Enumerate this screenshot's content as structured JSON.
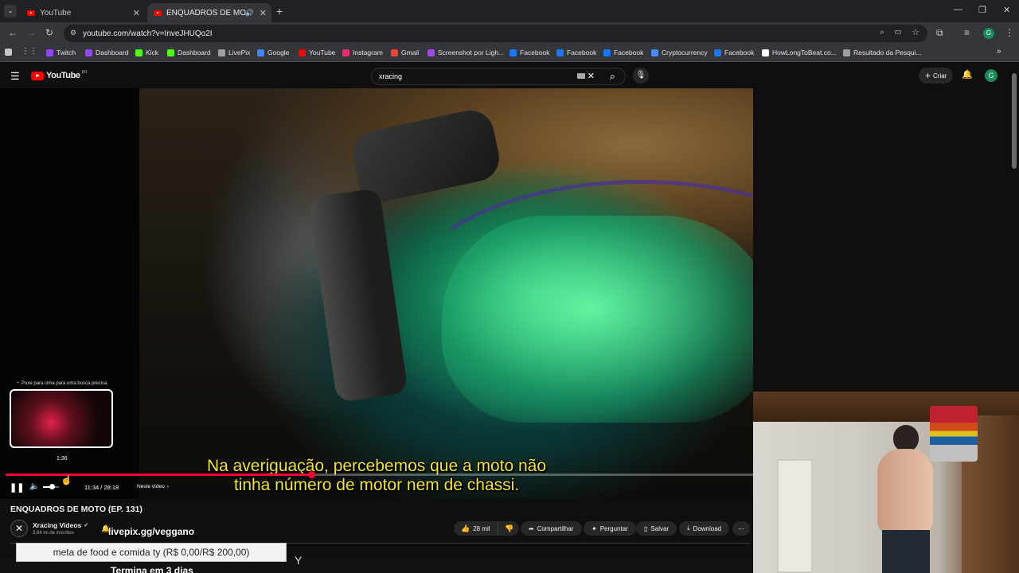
{
  "browser": {
    "tabs": [
      {
        "label": "YouTube",
        "active": false
      },
      {
        "label": "ENQUADROS DE MOTO (EP",
        "active": true
      }
    ],
    "url": "youtube.com/watch?v=InveJHUQo2I",
    "bookmarks": [
      {
        "label": "Twitch",
        "color": "#9146ff"
      },
      {
        "label": "Dashboard",
        "color": "#9146ff"
      },
      {
        "label": "Kick",
        "color": "#53fc18"
      },
      {
        "label": "Dashboard",
        "color": "#53fc18"
      },
      {
        "label": "LivePix",
        "color": "#9aa0a6"
      },
      {
        "label": "Google",
        "color": "#4285f4"
      },
      {
        "label": "YouTube",
        "color": "#ff0000"
      },
      {
        "label": "Instagram",
        "color": "#e1306c"
      },
      {
        "label": "Gmail",
        "color": "#ea4335"
      },
      {
        "label": "Screenshot por Ligh...",
        "color": "#a142f4"
      },
      {
        "label": "Facebook",
        "color": "#1877f2"
      },
      {
        "label": "Facebook",
        "color": "#1877f2"
      },
      {
        "label": "Facebook",
        "color": "#1877f2"
      },
      {
        "label": "Cryptocurrency",
        "color": "#4a8af4"
      },
      {
        "label": "Facebook",
        "color": "#1877f2"
      },
      {
        "label": "HowLongToBeat.co...",
        "color": "#ffffff"
      },
      {
        "label": "Resultado da Pesqui...",
        "color": "#9aa0a6"
      }
    ]
  },
  "youtube": {
    "logo": "YouTube",
    "logo_country": "BR",
    "search_query": "xracing",
    "create_label": "Criar",
    "avatar_letter": "G"
  },
  "player": {
    "subtitle_line1": "Na averiguação, percebemos que a moto não",
    "subtitle_line2": "tinha número de motor nem de chassi.",
    "seek_hint": "Puxe para cima para uma busca precisa",
    "preview_time": "1:36",
    "time_display": "11:34 / 28:18",
    "chapter_label": "Neste vídeo",
    "progress_fraction": 0.409,
    "volume_fraction": 0.55
  },
  "video_info": {
    "title": "ENQUADROS DE MOTO (EP. 131)",
    "channel_name": "Xracing Videos",
    "subscribers": "3,64 mi de inscritos",
    "likes": "28 mil",
    "share_label": "Compartilhar",
    "ask_label": "Perguntar",
    "save_label": "Salvar",
    "download_label": "Download"
  },
  "stream_overlay": {
    "pix_text": "livepix.gg/veggano",
    "goal_text": "meta de food e comida ty (R$ 0,00/R$ 200,00)",
    "ends_text": "Termina em 3 dias"
  }
}
